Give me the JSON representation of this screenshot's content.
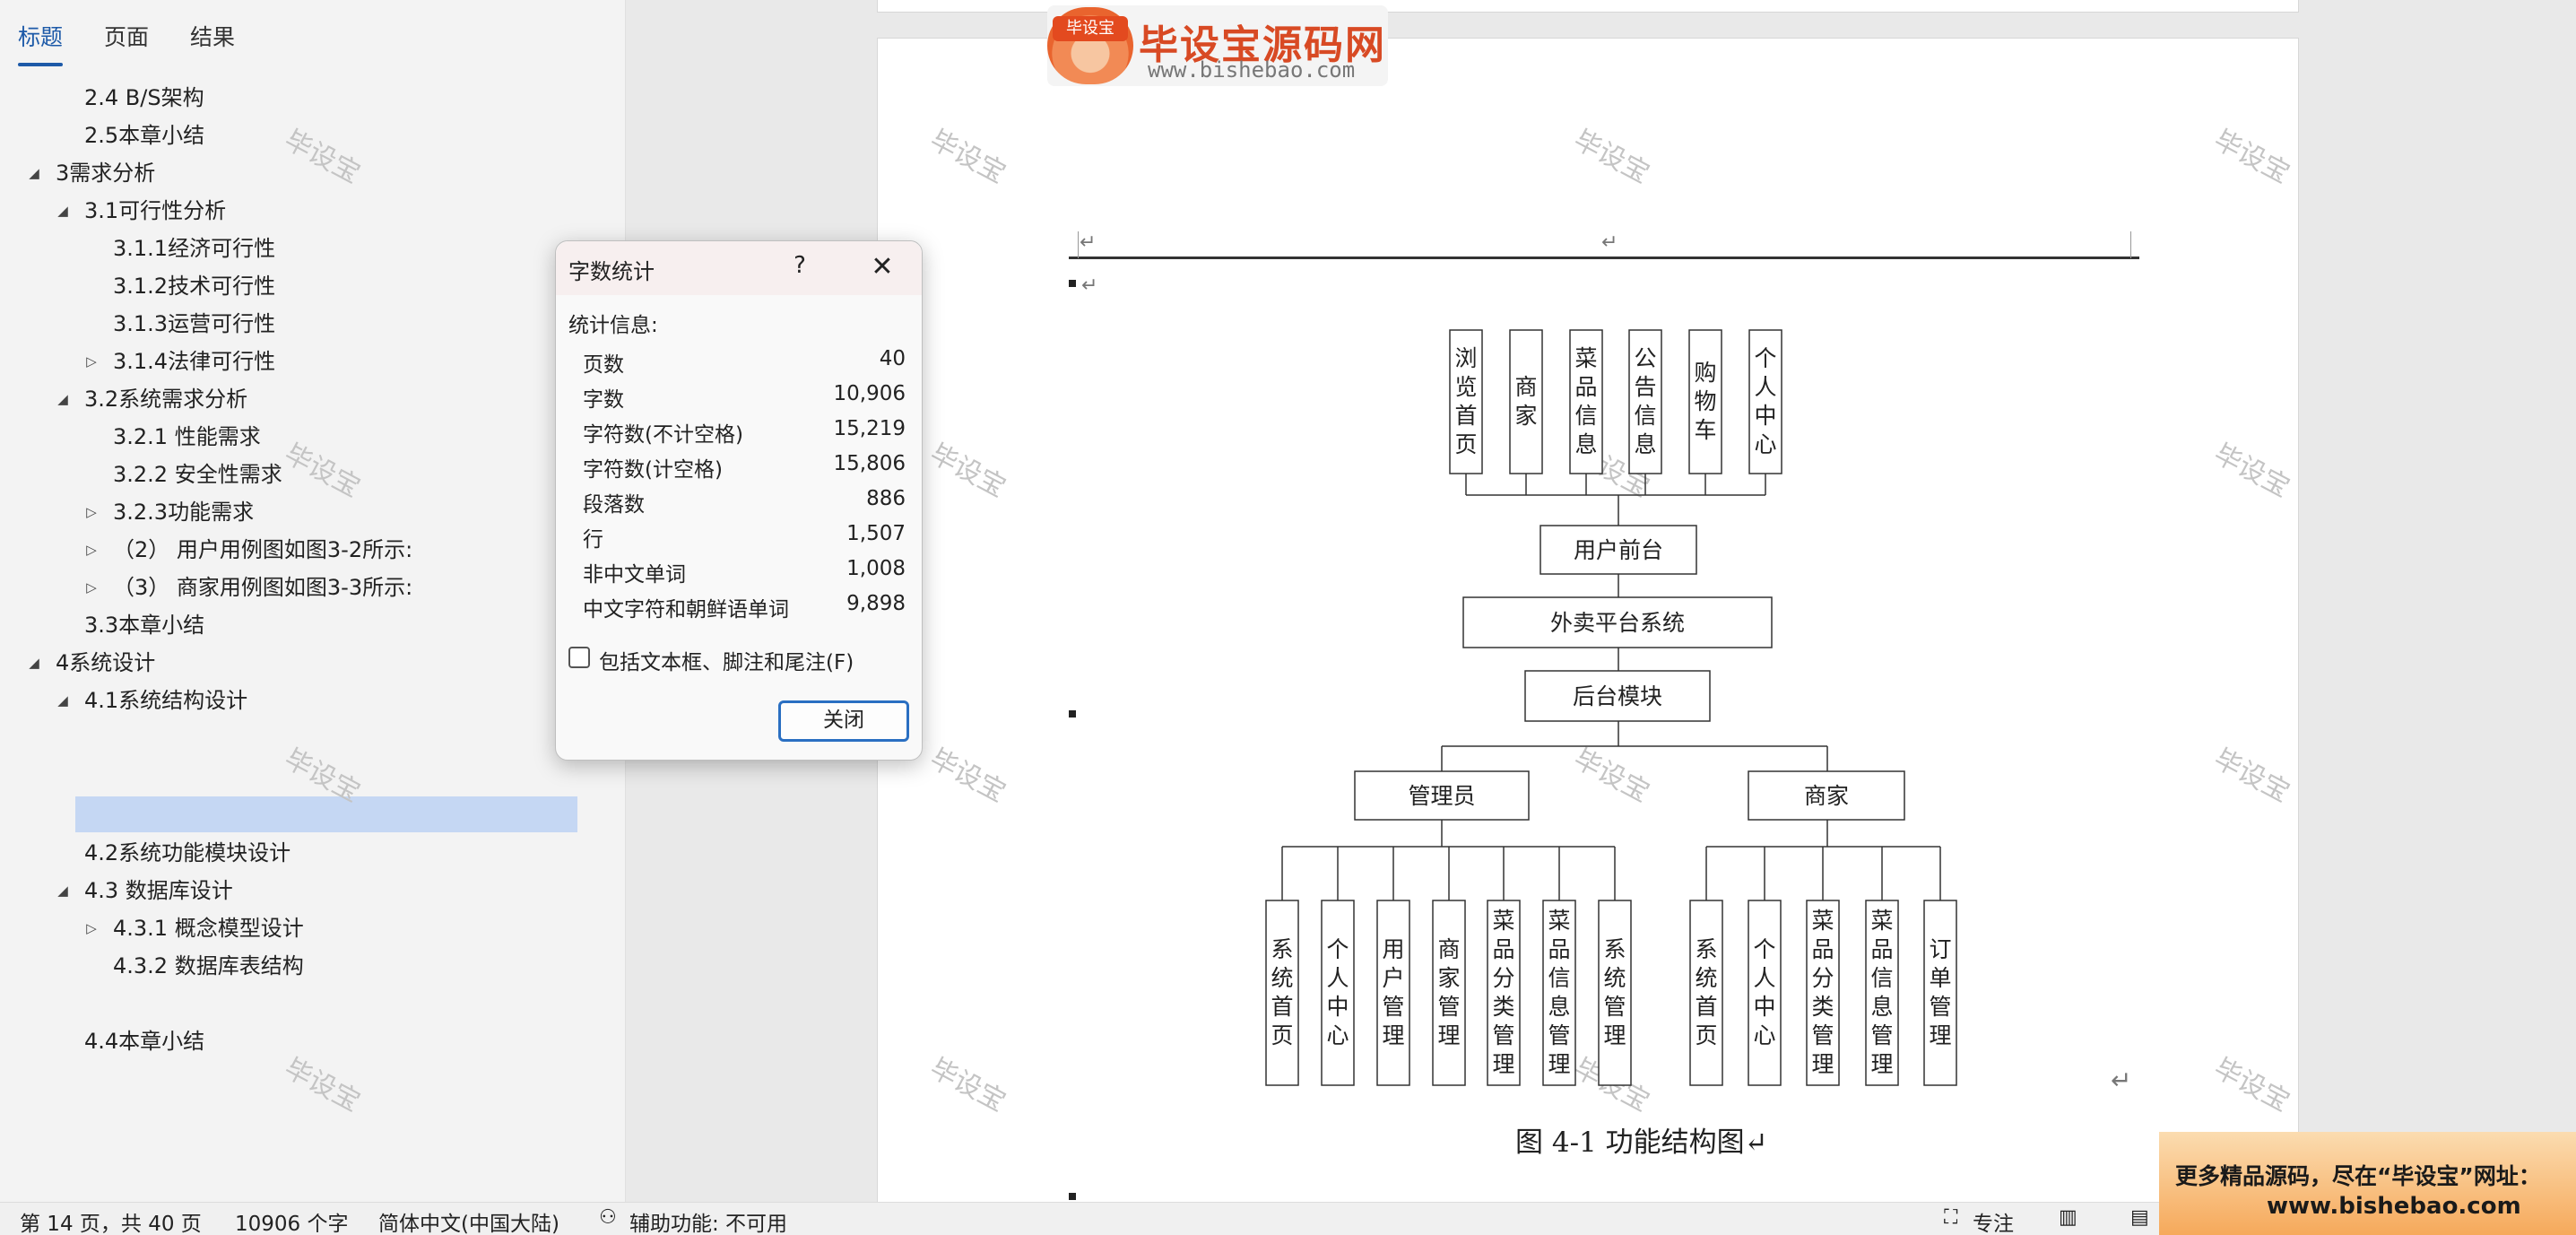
{
  "nav": {
    "tabs": [
      {
        "label": "标题"
      },
      {
        "label": "页面"
      },
      {
        "label": "结果"
      }
    ],
    "items": [
      {
        "label": "2.4 B/S架构"
      },
      {
        "label": "2.5本章小结"
      },
      {
        "label": "3需求分析"
      },
      {
        "label": "3.1可行性分析"
      },
      {
        "label": "3.1.1经济可行性"
      },
      {
        "label": "3.1.2技术可行性"
      },
      {
        "label": "3.1.3运营可行性"
      },
      {
        "label": "3.1.4法律可行性"
      },
      {
        "label": "3.2系统需求分析"
      },
      {
        "label": "3.2.1 性能需求"
      },
      {
        "label": "3.2.2 安全性需求"
      },
      {
        "label": "3.2.3功能需求"
      },
      {
        "label": "（2） 用户用例图如图3-2所示:"
      },
      {
        "label": "（3） 商家用例图如图3-3所示:"
      },
      {
        "label": "3.3本章小结"
      },
      {
        "label": "4系统设计"
      },
      {
        "label": "4.1系统结构设计"
      },
      {
        "label": "4.2系统功能模块设计"
      },
      {
        "label": "4.3 数据库设计"
      },
      {
        "label": "4.3.1 概念模型设计"
      },
      {
        "label": "4.3.2 数据库表结构"
      },
      {
        "label": "4.4本章小结"
      }
    ]
  },
  "watermark": "毕设宝",
  "logo": {
    "badge": "毕设宝",
    "title": "毕设宝源码网",
    "url": "www.bishebao.com"
  },
  "diagram": {
    "top_modules": [
      "浏览首页",
      "商家",
      "菜品信息",
      "公告信息",
      "购物车",
      "个人中心"
    ],
    "front": "用户前台",
    "system": "外卖平台系统",
    "backend": "后台模块",
    "admin": "管理员",
    "merchant": "商家",
    "admin_modules": [
      "系统首页",
      "个人中心",
      "用户管理",
      "商家管理",
      "菜品分类管理",
      "菜品信息管理",
      "系统管理"
    ],
    "merchant_modules": [
      "系统首页",
      "个人中心",
      "菜品分类管理",
      "菜品信息管理",
      "订单管理"
    ],
    "caption": "图 4-1 功能结构图↵"
  },
  "dialog": {
    "title": "字数统计",
    "help": "?",
    "section": "统计信息:",
    "stats": [
      {
        "label": "页数",
        "value": "40"
      },
      {
        "label": "字数",
        "value": "10,906"
      },
      {
        "label": "字符数(不计空格)",
        "value": "15,219"
      },
      {
        "label": "字符数(计空格)",
        "value": "15,806"
      },
      {
        "label": "段落数",
        "value": "886"
      },
      {
        "label": "行",
        "value": "1,507"
      },
      {
        "label": "非中文单词",
        "value": "1,008"
      },
      {
        "label": "中文字符和朝鲜语单词",
        "value": "9,898"
      }
    ],
    "checkbox_label": "包括文本框、脚注和尾注(F)",
    "checkbox_checked": false,
    "close_button": "关闭"
  },
  "status": {
    "page": "第 14 页，共 40 页",
    "words": "10906 个字",
    "language": "简体中文(中国大陆)",
    "accessibility": "辅助功能: 不可用",
    "focus": "专注"
  },
  "promo": {
    "line1": "更多精品源码，尽在“毕设宝”网址：",
    "line2": "www.bishebao.com"
  }
}
